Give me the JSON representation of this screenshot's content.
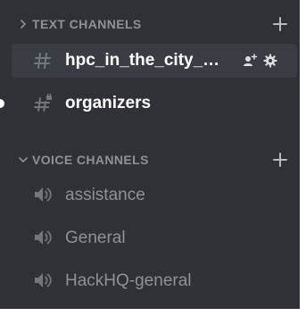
{
  "categories": {
    "text": {
      "label": "TEXT CHANNELS",
      "collapsed_icon": "chevron-right-icon",
      "add_icon": "plus-icon"
    },
    "voice": {
      "label": "VOICE CHANNELS",
      "expanded_icon": "chevron-down-icon",
      "add_icon": "plus-icon"
    }
  },
  "text_channels": [
    {
      "name": "hpc_in_the_city_st...",
      "icon": "hashtag-icon",
      "selected": true,
      "actions": [
        "invite-member-icon",
        "gear-icon"
      ]
    },
    {
      "name": "organizers",
      "icon": "hashtag-lock-icon",
      "selected": false,
      "unread": true
    }
  ],
  "voice_channels": [
    {
      "name": "assistance",
      "icon": "speaker-icon"
    },
    {
      "name": "General",
      "icon": "speaker-icon"
    },
    {
      "name": "HackHQ-general",
      "icon": "speaker-icon"
    }
  ],
  "colors": {
    "background": "#2f3136",
    "selected": "#393c43",
    "muted": "#8e9297",
    "text_active": "#ffffff",
    "icon_text_channel": "#72767d",
    "icon_actions": "#dcddde",
    "icon_voice": "#72767d"
  }
}
